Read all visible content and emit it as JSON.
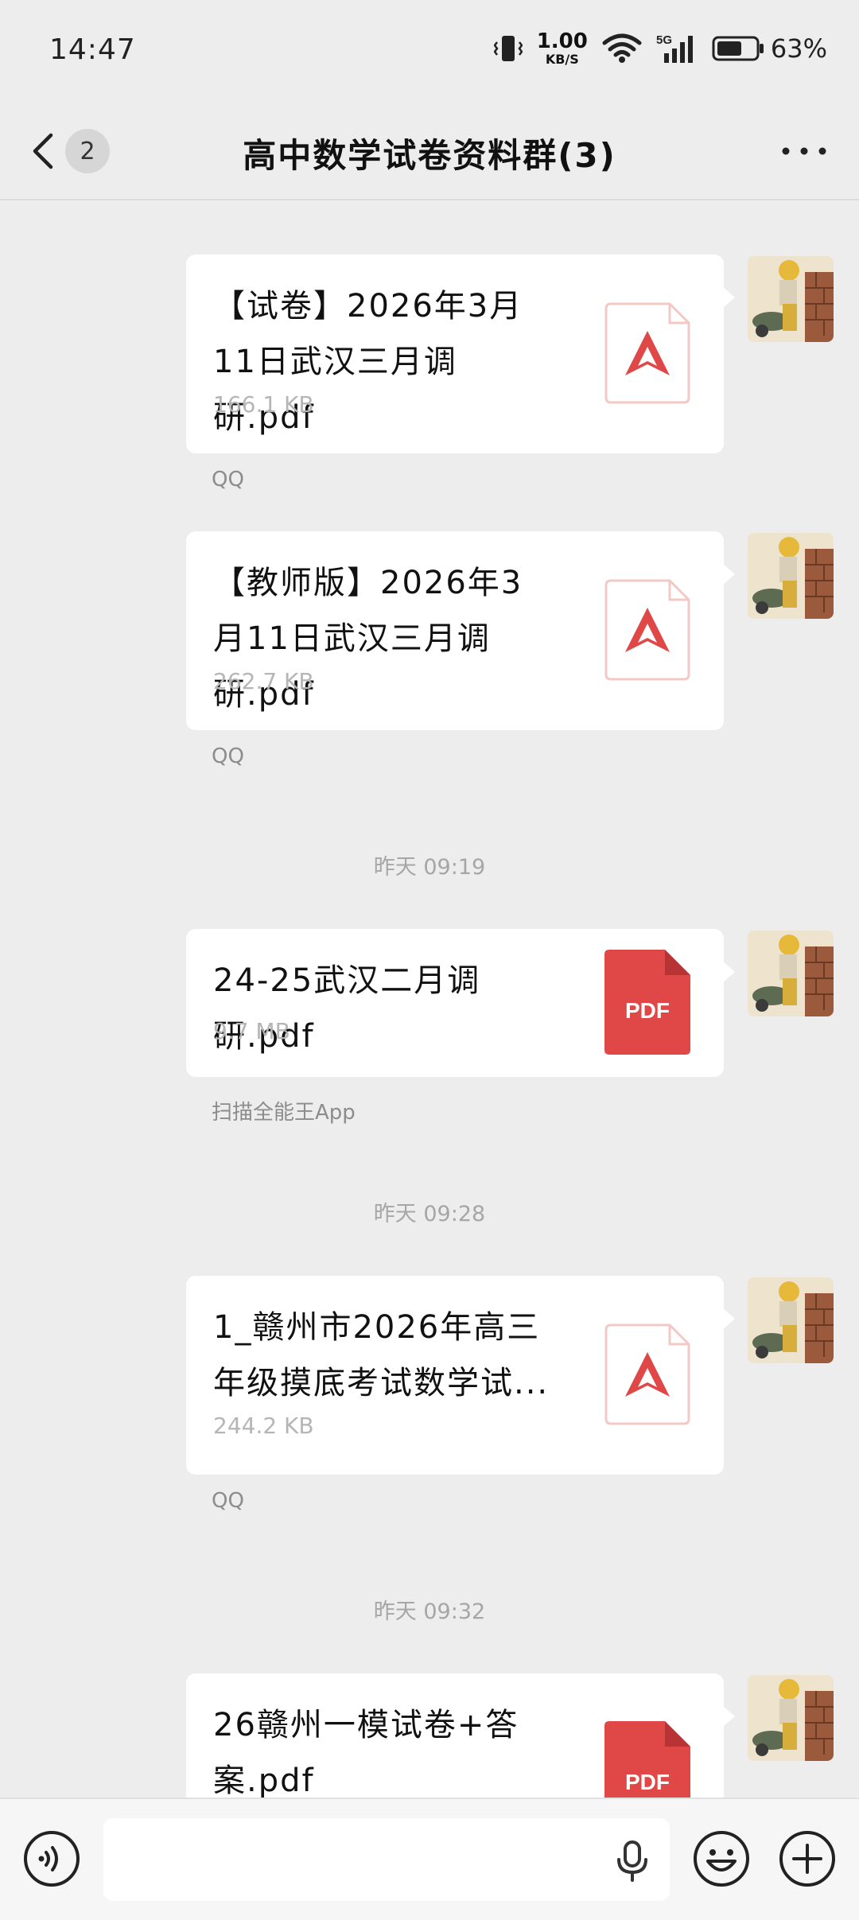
{
  "status_bar": {
    "time": "14:47",
    "net_speed_value": "1.00",
    "net_speed_unit": "KB/S",
    "network": "5G",
    "battery_pct": "63%"
  },
  "nav": {
    "unread_badge": "2",
    "title": "高中数学试卷资料群(3)"
  },
  "messages": [
    {
      "file_name": "【试卷】2026年3月11日武汉三月调研.pdf",
      "file_size": "166.1 KB",
      "icon": "pdf-outline-icon",
      "source": "QQ"
    },
    {
      "file_name": "【教师版】2026年3月11日武汉三月调研.pdf",
      "file_size": "262.7 KB",
      "icon": "pdf-outline-icon",
      "source": "QQ"
    },
    {
      "timestamp": "昨天 09:19"
    },
    {
      "file_name": "24-25武汉二月调研.pdf",
      "file_size": "9.7 MB",
      "icon": "pdf-red-icon",
      "icon_label": "PDF",
      "source": "扫描全能王App"
    },
    {
      "timestamp": "昨天 09:28"
    },
    {
      "file_name": "1_赣州市2026年高三年级摸底考试数学试...",
      "file_size": "244.2 KB",
      "icon": "pdf-outline-icon",
      "source": "QQ"
    },
    {
      "timestamp": "昨天 09:32"
    },
    {
      "file_name": "26赣州一模试卷+答案.pdf",
      "icon": "pdf-red-icon",
      "icon_label": "PDF"
    }
  ],
  "input": {
    "placeholder": "",
    "voice_icon": "voice-icon",
    "mic_icon": "microphone-icon",
    "emoji_icon": "emoji-icon",
    "plus_icon": "plus-icon"
  },
  "colors": {
    "background": "#ededed",
    "bubble": "#ffffff",
    "pdf_red": "#e04848",
    "pdf_outline": "#f2c9c5"
  }
}
